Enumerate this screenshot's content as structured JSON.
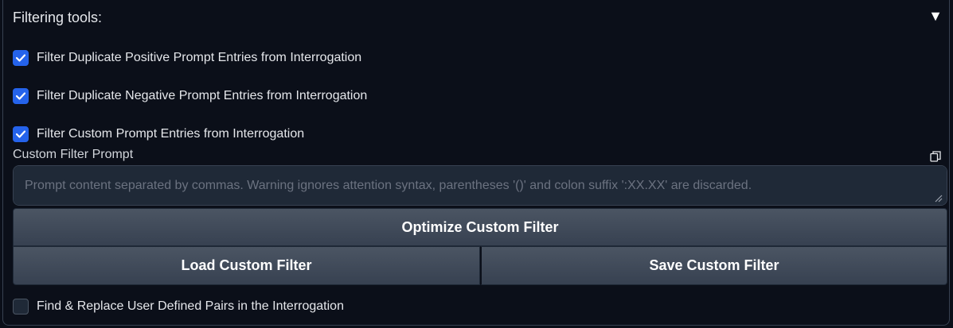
{
  "panel": {
    "title": "Filtering tools:",
    "collapse_icon": "▼"
  },
  "checkboxes": [
    {
      "label": "Filter Duplicate Positive Prompt Entries from Interrogation",
      "checked": true
    },
    {
      "label": "Filter Duplicate Negative Prompt Entries from Interrogation",
      "checked": true
    },
    {
      "label": "Filter Custom Prompt Entries from Interrogation",
      "checked": true
    },
    {
      "label": "Find & Replace User Defined Pairs in the Interrogation",
      "checked": false
    }
  ],
  "custom_filter": {
    "label": "Custom Filter Prompt",
    "value": "",
    "placeholder": "Prompt content separated by commas. Warning ignores attention syntax, parentheses '()' and colon suffix ':XX.XX' are discarded."
  },
  "buttons": {
    "optimize": "Optimize Custom Filter",
    "load": "Load Custom Filter",
    "save": "Save Custom Filter"
  },
  "colors": {
    "accent": "#2563eb",
    "background": "#0b0f19",
    "button": "#4b5563"
  }
}
